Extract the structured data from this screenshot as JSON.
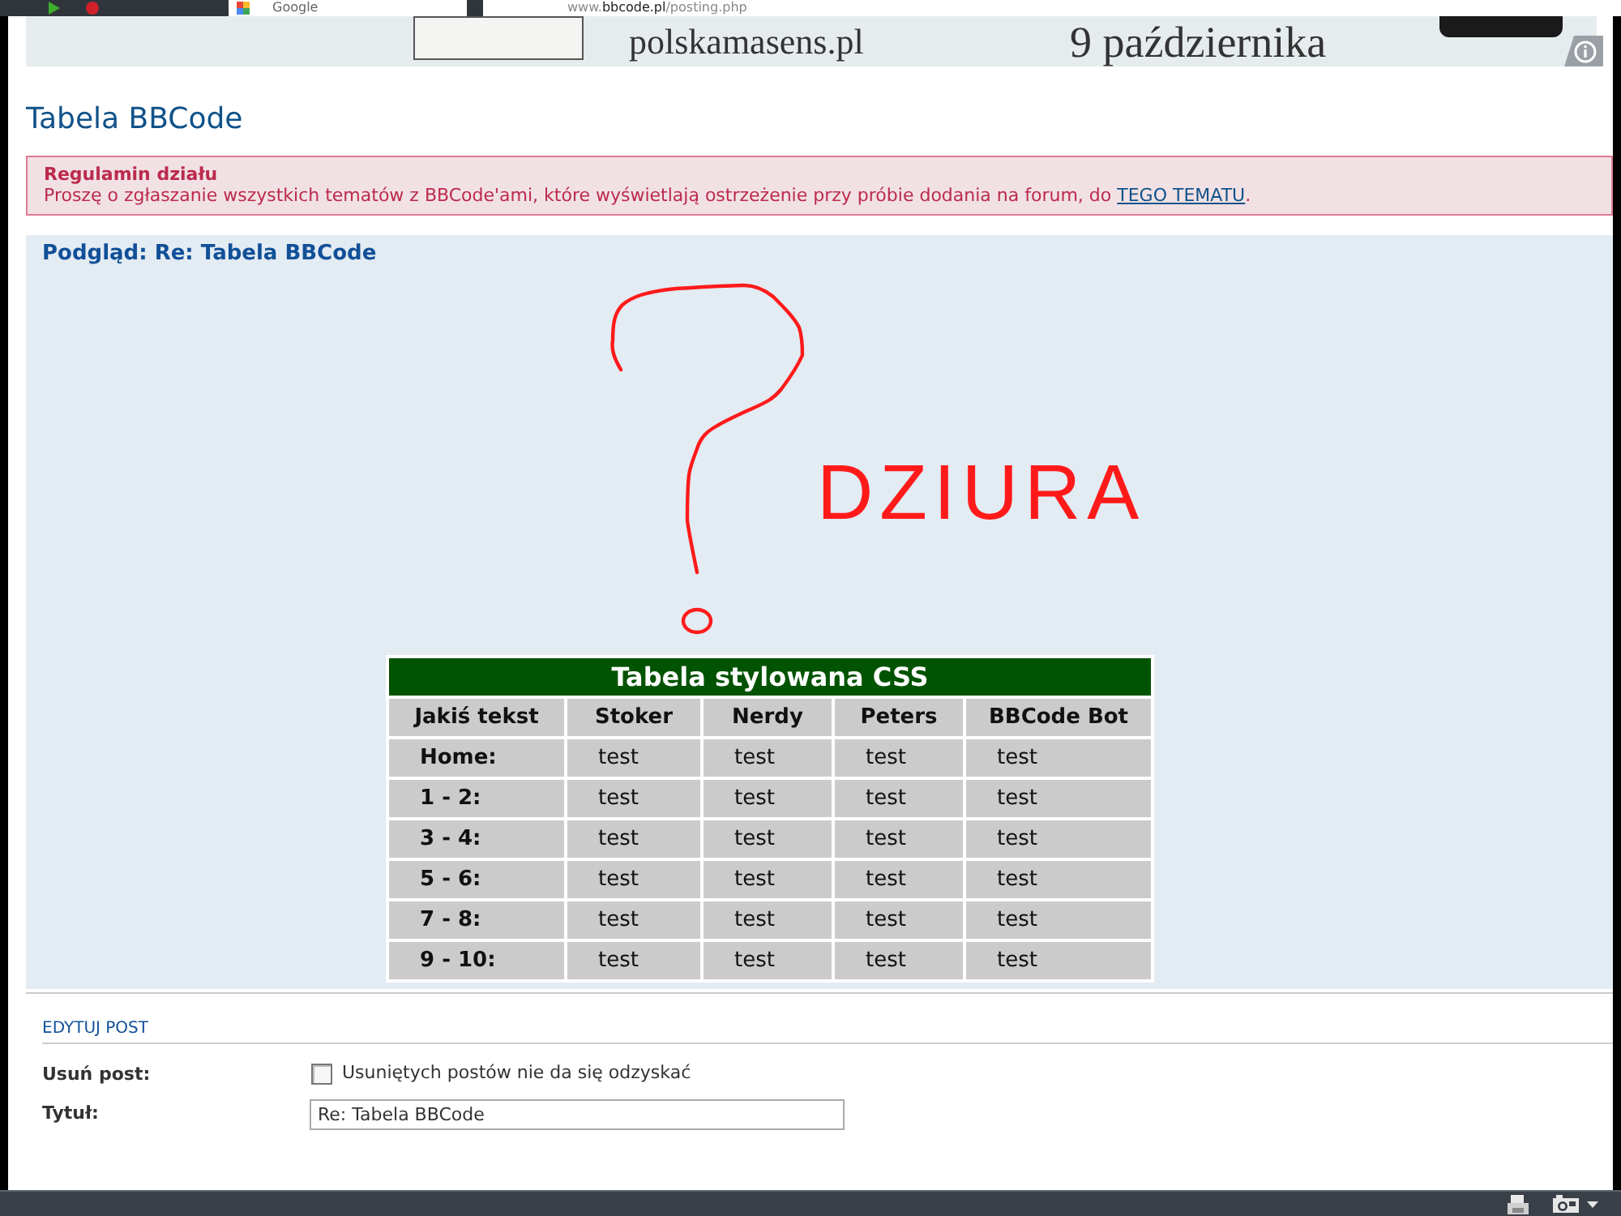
{
  "browser": {
    "tab": {
      "title": "Google"
    },
    "address": "www.**bbcode.pl**/posting.php"
  },
  "ad_banner": {
    "site": "polskamasens.pl",
    "date": "9 października"
  },
  "page_title": "Tabela BBCode",
  "rules": {
    "title": "Regulamin działu",
    "text": "Proszę o zgłaszanie wszystkich tematów z BBCode'ami, które wyświetlają ostrzeżenie przy próbie dodania na forum, do ",
    "link": "TEGO TEMATU",
    "text_end": "."
  },
  "preview": {
    "title": "Podgląd: Re: Tabela BBCode",
    "sketch_text": "DZIURA",
    "table": {
      "caption": "Tabela stylowana CSS",
      "columns": [
        "Jakiś tekst",
        "Stoker",
        "Nerdy",
        "Peters",
        "BBCode Bot"
      ],
      "rows": [
        [
          "Home:",
          "test",
          "test",
          "test",
          "test"
        ],
        [
          "1 - 2:",
          "test",
          "test",
          "test",
          "test"
        ],
        [
          "3 - 4:",
          "test",
          "test",
          "test",
          "test"
        ],
        [
          "5 - 6:",
          "test",
          "test",
          "test",
          "test"
        ],
        [
          "7 - 8:",
          "test",
          "test",
          "test",
          "test"
        ],
        [
          "9 - 10:",
          "test",
          "test",
          "test",
          "test"
        ]
      ]
    }
  },
  "edit_post": {
    "heading": "EDYTUJ POST",
    "fields": [
      {
        "kind": "checkbox",
        "label": "Usuń post:",
        "checked": false,
        "text": "Usuniętych postów nie da się odzyskać"
      },
      {
        "kind": "text",
        "label": "Tytuł:",
        "value": "Re: Tabela BBCode"
      }
    ]
  }
}
